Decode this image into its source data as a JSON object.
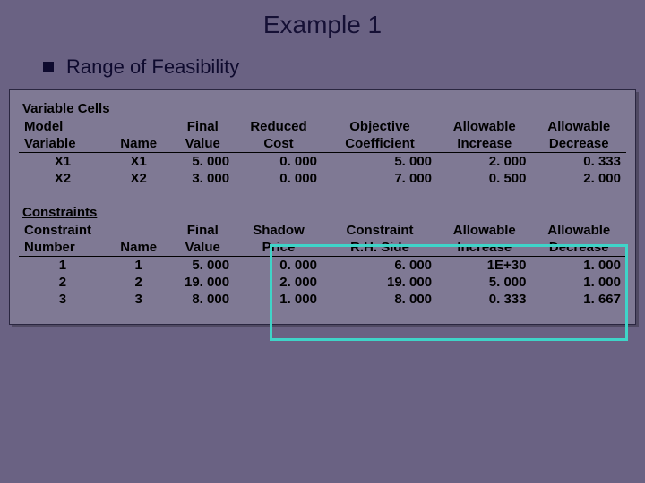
{
  "title": "Example 1",
  "subtitle": "Range of Feasibility",
  "variableCells": {
    "label": "Variable Cells",
    "headers": {
      "col1a": "Model",
      "col1b": "Variable",
      "col2a": "",
      "col2b": "Name",
      "col3a": "Final",
      "col3b": "Value",
      "col4a": "Reduced",
      "col4b": "Cost",
      "col5a": "Objective",
      "col5b": "Coefficient",
      "col6a": "Allowable",
      "col6b": "Increase",
      "col7a": "Allowable",
      "col7b": "Decrease"
    },
    "rows": [
      {
        "model": "X1",
        "name": "X1",
        "final": "5. 000",
        "reduced": "0. 000",
        "obj": "5. 000",
        "inc": "2. 000",
        "dec": "0. 333"
      },
      {
        "model": "X2",
        "name": "X2",
        "final": "3. 000",
        "reduced": "0. 000",
        "obj": "7. 000",
        "inc": "0. 500",
        "dec": "2. 000"
      }
    ]
  },
  "constraints": {
    "label": "Constraints",
    "headers": {
      "col1a": "Constraint",
      "col1b": "Number",
      "col2a": "",
      "col2b": "Name",
      "col3a": "Final",
      "col3b": "Value",
      "col4a": "Shadow",
      "col4b": "Price",
      "col5a": "Constraint",
      "col5b": "R.H. Side",
      "col6a": "Allowable",
      "col6b": "Increase",
      "col7a": "Allowable",
      "col7b": "Decrease"
    },
    "rows": [
      {
        "num": "1",
        "name": "1",
        "final": "5. 000",
        "shadow": "0. 000",
        "rhs": "6. 000",
        "inc": "1E+30",
        "dec": "1. 000"
      },
      {
        "num": "2",
        "name": "2",
        "final": "19. 000",
        "shadow": "2. 000",
        "rhs": "19. 000",
        "inc": "5. 000",
        "dec": "1. 000"
      },
      {
        "num": "3",
        "name": "3",
        "final": "8. 000",
        "shadow": "1. 000",
        "rhs": "8. 000",
        "inc": "0. 333",
        "dec": "1. 667"
      }
    ]
  }
}
